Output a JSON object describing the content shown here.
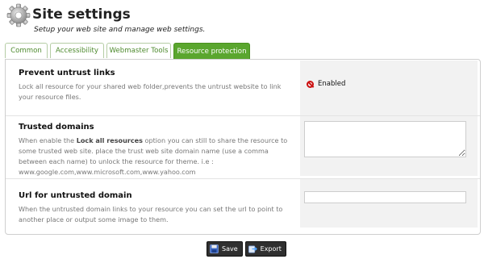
{
  "header": {
    "title": "Site settings",
    "subtitle": "Setup your web site and manage web settings.",
    "icon": "gear-icon"
  },
  "tabs": [
    {
      "label": "Common",
      "active": false
    },
    {
      "label": "Accessibility",
      "active": false
    },
    {
      "label": "Webmaster Tools",
      "active": false
    },
    {
      "label": "Resource protection",
      "active": true
    }
  ],
  "settings": {
    "prevent_untrust": {
      "title": "Prevent untrust links",
      "description": "Lock all resource for your shared web folder,prevents the untrust website to link your resource files.",
      "status": "Enabled",
      "status_icon": "disabled-circle-icon"
    },
    "trusted_domains": {
      "title": "Trusted domains",
      "desc_prefix": "When enable the ",
      "desc_bold": "Lock all resources",
      "desc_suffix": " option you can still to share the resource to some trusted web site. place the trust web site domain name (use a comma between each name) to unlock the resource for theme. i.e : www.google.com,www.microsoft.com,www.yahoo.com",
      "value": ""
    },
    "untrusted_url": {
      "title": "Url for untrusted domain",
      "description": "When the untrusted domain links to your resource you can set the url to point to another place or output some image to them.",
      "value": ""
    }
  },
  "buttons": {
    "save_label": "Save",
    "export_label": "Export"
  },
  "colors": {
    "tab_active": "#5aa62e",
    "tab_text": "#4e8a2e",
    "status_icon": "#cc1111"
  }
}
